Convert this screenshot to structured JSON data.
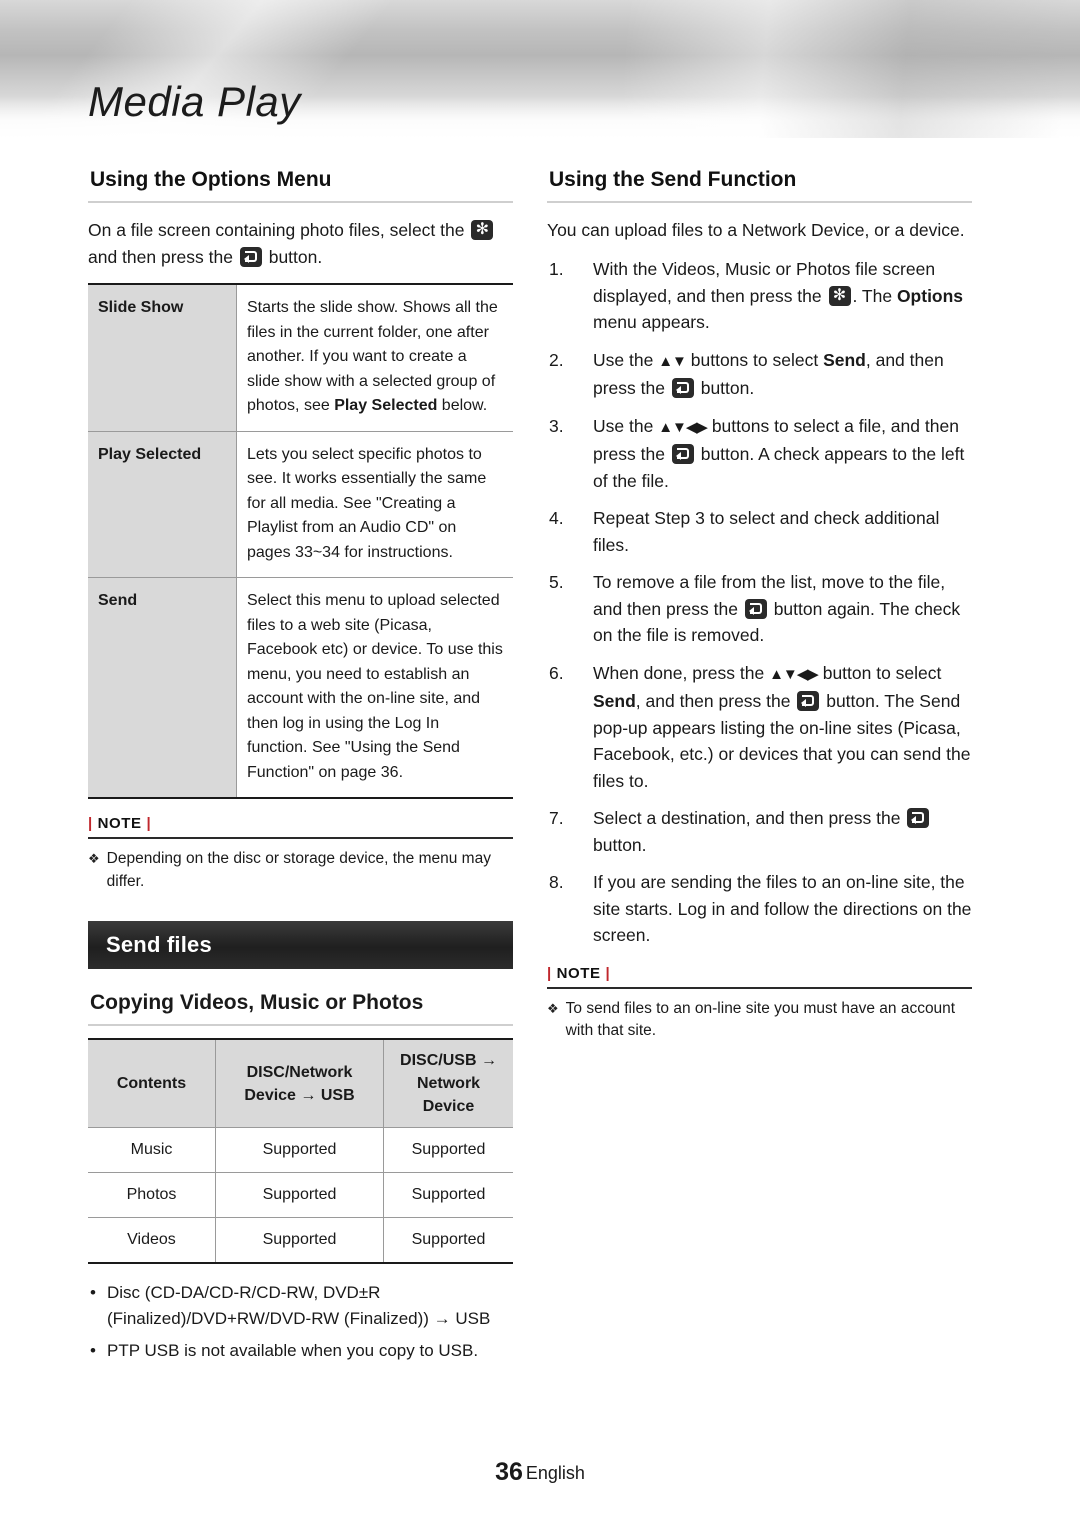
{
  "header": {
    "chapter_title": "Media Play"
  },
  "left_column": {
    "options_section": {
      "title": "Using the Options Menu",
      "intro_a": "On a file screen containing photo files, select the",
      "intro_b": "and then press the",
      "intro_c": "button.",
      "rows": [
        {
          "name": "Slide Show",
          "desc_1": "Starts the slide show. Shows all the files in the current folder, one after another. If you want to create a slide show with a selected group of photos,",
          "desc_2_pre": "see ",
          "desc_2_bold": "Play Selected",
          "desc_2_post": " below."
        },
        {
          "name": "Play Selected",
          "desc_1": "Lets you select specific photos to see. It works essentially the same for all media.",
          "desc_2": "See \"Creating a Playlist from an Audio CD\" on pages 33~34 for instructions."
        },
        {
          "name": "Send",
          "desc_1": "Select this menu to upload selected files to a web site (Picasa, Facebook etc) or device. To use this menu, you need to establish an account with the on-line site, and then log in using the Log In function.",
          "desc_2": "See \"Using the Send Function\" on page 36."
        }
      ]
    },
    "note": {
      "label": "NOTE",
      "items": [
        "Depending on the disc or storage device, the menu may differ."
      ]
    },
    "banner": "Send files",
    "copying_section": {
      "title": "Copying Videos, Music or Photos",
      "table": {
        "headers": [
          "Contents",
          "DISC/Network Device → USB",
          "DISC/USB → Network Device"
        ],
        "header_parts": [
          {
            "line1": "Contents",
            "line2": ""
          },
          {
            "line1": "DISC/Network",
            "line2": "Device → USB"
          },
          {
            "line1": "DISC/USB →",
            "line2": "Network Device"
          }
        ],
        "rows": [
          [
            "Music",
            "Supported",
            "Supported"
          ],
          [
            "Photos",
            "Supported",
            "Supported"
          ],
          [
            "Videos",
            "Supported",
            "Supported"
          ]
        ]
      },
      "bullets": [
        "Disc (CD-DA/CD-R/CD-RW, DVD±R (Finalized)/DVD+RW/DVD-RW (Finalized)) → USB",
        "PTP USB is not available when you copy to USB."
      ]
    }
  },
  "right_column": {
    "send_function_section": {
      "title": "Using the Send Function",
      "intro": "You can upload files to a Network Device, or a device.",
      "steps": [
        {
          "num": "1.",
          "parts": [
            {
              "t": "text",
              "v": "With the Videos, Music or Photos file screen displayed, and then press the "
            },
            {
              "t": "icon",
              "v": "tools-button-icon"
            },
            {
              "t": "text",
              "v": ". The "
            },
            {
              "t": "bold",
              "v": "Options"
            },
            {
              "t": "text",
              "v": " menu appears."
            }
          ]
        },
        {
          "num": "2.",
          "parts": [
            {
              "t": "text",
              "v": "Use the "
            },
            {
              "t": "arrows",
              "v": "▲▼"
            },
            {
              "t": "text",
              "v": " buttons to select "
            },
            {
              "t": "bold",
              "v": "Send"
            },
            {
              "t": "text",
              "v": ", and then press the "
            },
            {
              "t": "icon",
              "v": "enter-button-icon"
            },
            {
              "t": "text",
              "v": " button."
            }
          ]
        },
        {
          "num": "3.",
          "parts": [
            {
              "t": "text",
              "v": "Use the "
            },
            {
              "t": "arrows",
              "v": "▲▼◀▶"
            },
            {
              "t": "text",
              "v": " buttons to select a file, and then press the "
            },
            {
              "t": "icon",
              "v": "enter-button-icon"
            },
            {
              "t": "text",
              "v": " button. A check appears to the left of the file."
            }
          ]
        },
        {
          "num": "4.",
          "parts": [
            {
              "t": "text",
              "v": "Repeat Step 3 to select and check additional files."
            }
          ]
        },
        {
          "num": "5.",
          "parts": [
            {
              "t": "text",
              "v": "To remove a file from the list, move to the file, and then press the "
            },
            {
              "t": "icon",
              "v": "enter-button-icon"
            },
            {
              "t": "text",
              "v": " button again. The check on the file is removed."
            }
          ]
        },
        {
          "num": "6.",
          "parts": [
            {
              "t": "text",
              "v": "When done, press the "
            },
            {
              "t": "arrows",
              "v": "▲▼◀▶"
            },
            {
              "t": "text",
              "v": " button to select "
            },
            {
              "t": "bold",
              "v": "Send"
            },
            {
              "t": "text",
              "v": ", and then press the "
            },
            {
              "t": "icon",
              "v": "enter-button-icon"
            },
            {
              "t": "text",
              "v": " button. The Send pop-up appears listing the on-line sites (Picasa, Facebook, etc.) or devices that you can send the files to."
            }
          ]
        },
        {
          "num": "7.",
          "parts": [
            {
              "t": "text",
              "v": "Select a destination, and then press the "
            },
            {
              "t": "icon",
              "v": "enter-button-icon"
            },
            {
              "t": "text",
              "v": " button."
            }
          ]
        },
        {
          "num": "8.",
          "parts": [
            {
              "t": "text",
              "v": "If you are sending the files to an on-line site, the site starts. Log in and follow the directions on the screen."
            }
          ]
        }
      ]
    },
    "note": {
      "label": "NOTE",
      "items": [
        "To send files to an on-line site you must have an account with that site."
      ]
    }
  },
  "footer": {
    "page_number": "36",
    "language": "English"
  }
}
